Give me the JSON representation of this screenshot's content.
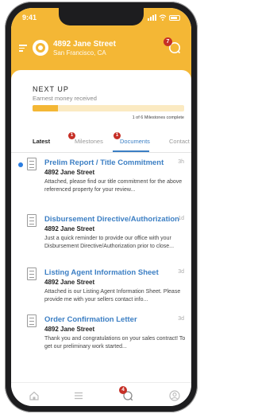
{
  "status_bar": {
    "time": "9:41"
  },
  "header": {
    "street": "4892 Jane Street",
    "city": "San Francisco, CA",
    "chat_badge": "7"
  },
  "next_up": {
    "title": "NEXT UP",
    "subtitle": "Earnest money received",
    "progress_fraction": 0.17,
    "count_label": "1 of 6 Milestones complete"
  },
  "tabs": [
    {
      "label": "Latest",
      "badge": ""
    },
    {
      "label": "Milestones",
      "badge": "1"
    },
    {
      "label": "Documents",
      "badge": "1"
    },
    {
      "label": "Contact",
      "badge": ""
    }
  ],
  "items": [
    {
      "title": "Prelim Report / Title Commitment",
      "time": "3h",
      "address": "4892 Jane Street",
      "body": "Attached, please find our title commitment for the above referenced property for your review..."
    },
    {
      "title": "Disbursement Directive/Authorization",
      "time": "1d",
      "address": "4892 Jane Street",
      "body": "Just a quick reminder to provide our office with your Disbursement Directive/Authorization prior to close..."
    },
    {
      "title": "Listing Agent Information Sheet",
      "time": "3d",
      "address": "4892 Jane Street",
      "body": "Attached is our Listing Agent Information Sheet. Please provide me with your sellers contact info..."
    },
    {
      "title": "Order Confirmation Letter",
      "time": "3d",
      "address": "4892 Jane Street",
      "body": "Thank you and congratulations on your sales contract! To get our preliminary work started..."
    }
  ],
  "bottom_nav": {
    "badge": "4"
  },
  "colors": {
    "accent": "#f4b735",
    "link": "#3c7fc4",
    "badge": "#c62f26",
    "unread": "#2a7de1"
  }
}
